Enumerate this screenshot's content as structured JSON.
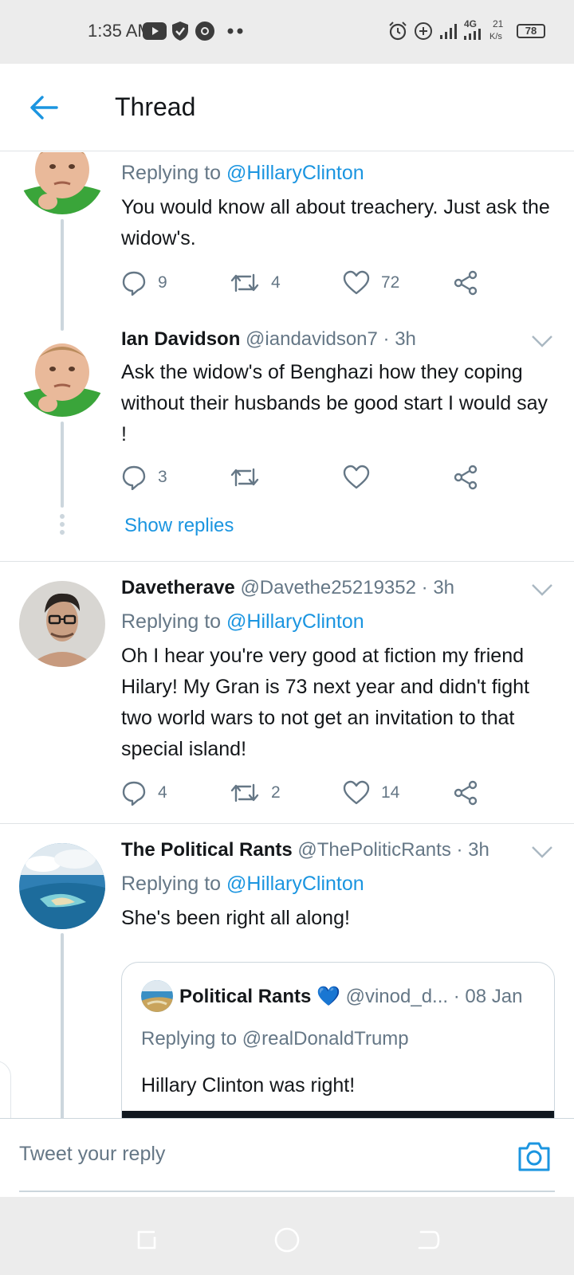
{
  "status_bar": {
    "time": "1:35 AM",
    "network": "4G",
    "speed_value": "21",
    "speed_unit": "K/s",
    "battery": "78"
  },
  "header": {
    "title": "Thread"
  },
  "tweets": [
    {
      "replying_label": "Replying to",
      "replying_handle": "@HillaryClinton",
      "text": "You would know all about treachery. Just ask the widow's.",
      "replies": "9",
      "retweets": "4",
      "likes": "72"
    },
    {
      "name": "Ian Davidson",
      "handle": "@iandavidson7",
      "time": "· 3h",
      "text": "Ask the widow's of Benghazi how they coping without their husbands be good start I would say !",
      "replies": "3",
      "retweets": "",
      "likes": ""
    },
    {
      "name": "Davetherave",
      "handle": "@Davethe25219352",
      "time": "· 3h",
      "replying_label": "Replying to",
      "replying_handle": "@HillaryClinton",
      "text": "Oh I hear you're very good at fiction my friend Hilary! My Gran is 73 next year and didn't fight two world wars to not get an invitation to that special island!",
      "replies": "4",
      "retweets": "2",
      "likes": "14"
    },
    {
      "name": "The Political Rants",
      "handle": "@ThePoliticRants",
      "time": "· 3h",
      "replying_label": "Replying to",
      "replying_handle": "@HillaryClinton",
      "text": "She's been right all along!"
    }
  ],
  "show_replies": "Show replies",
  "quoted_tweet": {
    "name": "Political Rants",
    "badge": "💙",
    "handle": "@vinod_d...",
    "time": "· 08 Jan",
    "replying": "Replying to @realDonaldTrump",
    "text": "Hillary Clinton was right!"
  },
  "reply_bar": {
    "placeholder": "Tweet your reply"
  },
  "colors": {
    "accent": "#1b95e0",
    "muted": "#657786",
    "text": "#14171a",
    "thread_line": "#ccd6dd"
  },
  "icons": {
    "back": "arrow-left-icon",
    "reply": "comment-icon",
    "retweet": "retweet-icon",
    "like": "heart-icon",
    "share": "share-icon",
    "more": "chevron-down-icon",
    "camera": "camera-icon"
  }
}
